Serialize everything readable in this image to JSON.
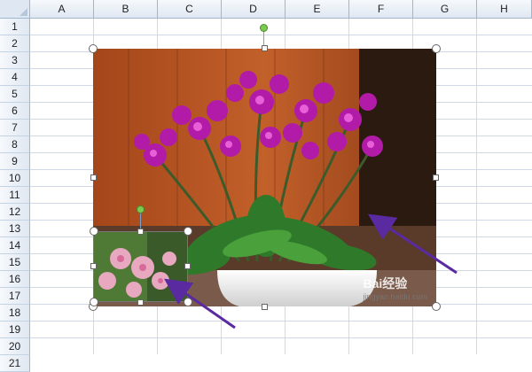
{
  "columns": [
    "A",
    "B",
    "C",
    "D",
    "E",
    "F",
    "G",
    "H"
  ],
  "rows": [
    "1",
    "2",
    "3",
    "4",
    "5",
    "6",
    "7",
    "8",
    "9",
    "10",
    "11",
    "12",
    "13",
    "14",
    "15",
    "16",
    "17",
    "18",
    "19",
    "20",
    "21"
  ],
  "images": {
    "main": {
      "alt": "Potted purple phalaenopsis orchid photo"
    },
    "small": {
      "alt": "Pink orchid thumbnail photo"
    }
  },
  "arrow_color": "#5a2aa0",
  "watermark": {
    "brand": "Bai经验",
    "url": "jingyan.baidu.com"
  }
}
